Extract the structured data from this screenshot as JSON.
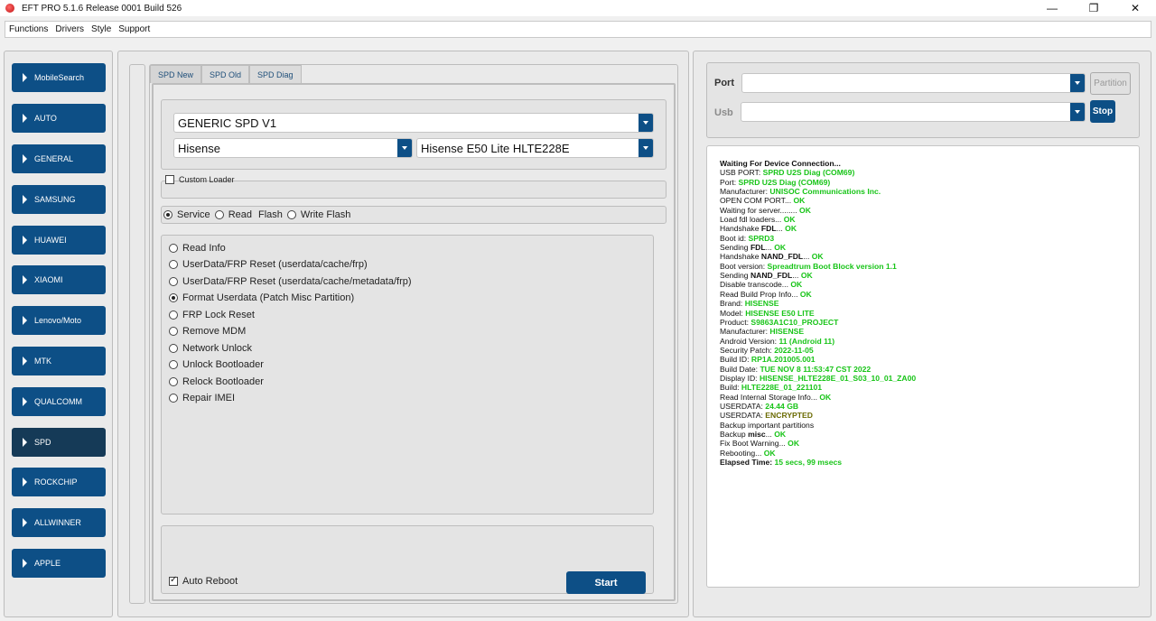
{
  "window": {
    "title": "EFT PRO 5.1.6 Release 0001 Build 526",
    "minimize": "—",
    "restore": "❐",
    "close": "✕"
  },
  "menu": [
    "Functions",
    "Drivers",
    "Style",
    "Support"
  ],
  "sidebar": {
    "items": [
      "MobileSearch",
      "AUTO",
      "GENERAL",
      "SAMSUNG",
      "HUAWEI",
      "XIAOMI",
      "Lenovo/Moto",
      "MTK",
      "QUALCOMM",
      "SPD",
      "ROCKCHIP",
      "ALLWINNER",
      "APPLE"
    ],
    "active": "SPD"
  },
  "tabs": [
    "SPD New",
    "SPD Old",
    "SPD Diag"
  ],
  "loader": {
    "model_family": "GENERIC SPD V1",
    "brand": "Hisense",
    "model": "Hisense E50 Lite HLTE228E"
  },
  "custom_loader": {
    "label": "Custom Loader",
    "checked": false
  },
  "modes": {
    "service": "Service",
    "read": "Read",
    "flash": "Flash",
    "write": "Write Flash",
    "selected": "Service"
  },
  "operations": [
    "Read Info",
    "UserData/FRP Reset (userdata/cache/frp)",
    "UserData/FRP Reset (userdata/cache/metadata/frp)",
    "Format Userdata (Patch Misc Partition)",
    "FRP Lock Reset",
    "Remove MDM",
    "Network Unlock",
    "Unlock Bootloader",
    "Relock Bootloader",
    "Repair IMEI"
  ],
  "selected_operation": "Format Userdata (Patch Misc Partition)",
  "auto_reboot": {
    "label": "Auto Reboot",
    "checked": true
  },
  "start_label": "Start",
  "connection": {
    "port_label": "Port",
    "usb_label": "Usb",
    "port_value": "",
    "usb_value": "",
    "partition_label": "Partition",
    "stop_label": "Stop"
  },
  "log": [
    {
      "t": "Waiting For Device Connection...",
      "bold": true
    },
    {
      "t": "USB PORT: ",
      "v": "SPRD U2S Diag (COM69)"
    },
    {
      "t": "Port: ",
      "v": "SPRD U2S Diag (COM69)"
    },
    {
      "t": "Manufacturer: ",
      "v": "UNISOC Communications Inc."
    },
    {
      "t": "OPEN COM PORT... ",
      "v": "OK"
    },
    {
      "t": "Waiting for server........ ",
      "v": "OK"
    },
    {
      "t": "Load fdl loaders... ",
      "v": "OK"
    },
    {
      "t": "Handshake ",
      "b": "FDL",
      "t2": "... ",
      "v": "OK"
    },
    {
      "t": "Boot id: ",
      "v": "SPRD3"
    },
    {
      "t": "Sending ",
      "b": "FDL",
      "t2": "... ",
      "v": "OK"
    },
    {
      "t": "Handshake ",
      "b": "NAND_FDL",
      "t2": "... ",
      "v": "OK"
    },
    {
      "t": "Boot version: ",
      "v": "Spreadtrum Boot Block version 1.1"
    },
    {
      "t": "Sending ",
      "b": "NAND_FDL",
      "t2": "... ",
      "v": "OK"
    },
    {
      "t": "Disable transcode... ",
      "v": "OK"
    },
    {
      "t": "Read Build Prop Info... ",
      "v": "OK"
    },
    {
      "t": " Brand: ",
      "v": "HISENSE"
    },
    {
      "t": " Model: ",
      "v": "HISENSE E50 LITE"
    },
    {
      "t": " Product: ",
      "v": "S9863A1C10_PROJECT"
    },
    {
      "t": " Manufacturer: ",
      "v": "HISENSE"
    },
    {
      "t": " Android Version: ",
      "v": "11 (Android 11)"
    },
    {
      "t": " Security Patch: ",
      "v": "2022-11-05"
    },
    {
      "t": " Build ID: ",
      "v": "RP1A.201005.001"
    },
    {
      "t": " Build Date: ",
      "v": "TUE NOV  8 11:53:47 CST 2022"
    },
    {
      "t": " Display ID: ",
      "v": "HISENSE_HLTE228E_01_S03_10_01_ZA00"
    },
    {
      "t": " Build: ",
      "v": "HLTE228E_01_221101"
    },
    {
      "t": "Read Internal Storage Info... ",
      "v": "OK"
    },
    {
      "t": "USERDATA: ",
      "v": "24.44 GB"
    },
    {
      "t": "USERDATA: ",
      "vy": "ENCRYPTED"
    },
    {
      "t": "Backup important partitions"
    },
    {
      "t": " Backup ",
      "b": "misc",
      "t2": "... ",
      "v": "OK"
    },
    {
      "t": "Fix Boot Warning... ",
      "v": "OK"
    },
    {
      "t": "Rebooting... ",
      "v": "OK"
    },
    {
      "bt": "Elapsed Time: ",
      "v": "15 secs, 99 msecs"
    }
  ],
  "colors": {
    "accent": "#0d4f86",
    "active_nav": "#153a57",
    "log_ok": "#17c417"
  }
}
